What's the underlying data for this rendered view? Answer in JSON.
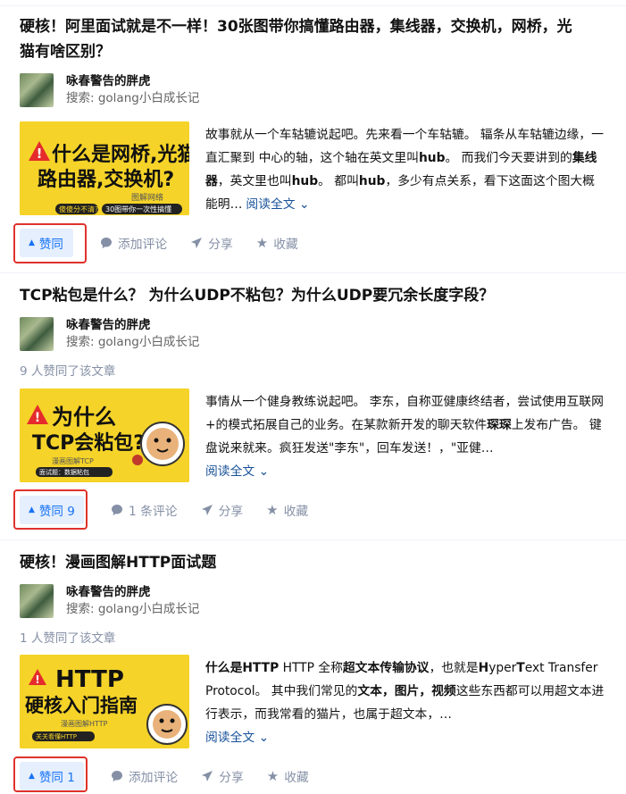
{
  "articles": [
    {
      "title_line1": "硬核！阿里面试就是不一样！30张图带你搞懂路由器，集线器，交换机，网桥，光",
      "title_line2": "猫有啥区别？",
      "author_name": "咏春警告的胖虎",
      "author_sub": "搜索: golang小白成长记",
      "likes_text": "",
      "thumb": {
        "line1": "什么是网桥,光猫",
        "line2": "路由器,交换机?",
        "tag": "图解网络",
        "badge1": "傻傻分不清?",
        "badge2": "30图带你一次性搞懂"
      },
      "excerpt": {
        "p1": "故事就从一个车轱辘说起吧。先来看一个车轱辘。 辐条从车轱辘边缘，一直汇聚到 中心的轴，这个轴在英文里叫",
        "b1": "hub",
        "p2": "。 而我们今天要讲到的",
        "b2": "集线器",
        "p3": "，英文里也叫",
        "b3": "hub",
        "p4": "。 都叫",
        "b4": "hub",
        "p5": "，多少有点关系，看下这面这个图大概能明…"
      },
      "read_more": "阅读全文",
      "vote_label": "赞同",
      "comment_label": "添加评论",
      "share_label": "分享",
      "fav_label": "收藏"
    },
    {
      "title_line1": "TCP粘包是什么？ 为什么UDP不粘包？为什么UDP要冗余长度字段？",
      "author_name": "咏春警告的胖虎",
      "author_sub": "搜索: golang小白成长记",
      "likes_text": "9 人赞同了该文章",
      "thumb": {
        "line1": "为什么",
        "line2": "TCP会粘包?",
        "tag": "漫画图解TCP",
        "badge1": "面试题：数据粘包"
      },
      "excerpt": {
        "p1": "事情从一个健身教练说起吧。 李东，自称亚健康终结者，尝试使用互联网+的模式拓展自己的业务。在某款新开发的聊天软件",
        "b1": "琛琛",
        "p2": "上发布广告。 键盘说来就来。疯狂发送\"李东\"，回车发送！，\"亚健…"
      },
      "read_more": "阅读全文",
      "vote_label": "赞同 9",
      "comment_label": "1 条评论",
      "share_label": "分享",
      "fav_label": "收藏"
    },
    {
      "title_line1": "硬核！漫画图解HTTP面试题",
      "author_name": "咏春警告的胖虎",
      "author_sub": "搜索: golang小白成长记",
      "likes_text": "1 人赞同了该文章",
      "thumb": {
        "line1": "HTTP",
        "line2": "硬核入门指南",
        "tag": "漫画图解HTTP",
        "badge1": "关关看懂HTTP"
      },
      "excerpt": {
        "b1": "什么是HTTP",
        "p1": " HTTP 全称",
        "b2": "超文本传输协议",
        "p2": "，也就是",
        "b3": "H",
        "p3": "yper",
        "b4": "T",
        "p4": "ext Transfer Protocol。 其中我们常见的",
        "b5": "文本，图片，视频",
        "p5": "这些东西都可以用超文本进行表示，而我常看的猫片，也属于超文本，…"
      },
      "read_more": "阅读全文",
      "vote_label": "赞同 1",
      "comment_label": "添加评论",
      "share_label": "分享",
      "fav_label": "收藏"
    }
  ],
  "colors": {
    "accent": "#1772f6",
    "vote_bg": "#e5effd",
    "highlight": "#e0322b",
    "muted": "#8590a6",
    "link": "#175199",
    "thumb": "#f5d328"
  }
}
